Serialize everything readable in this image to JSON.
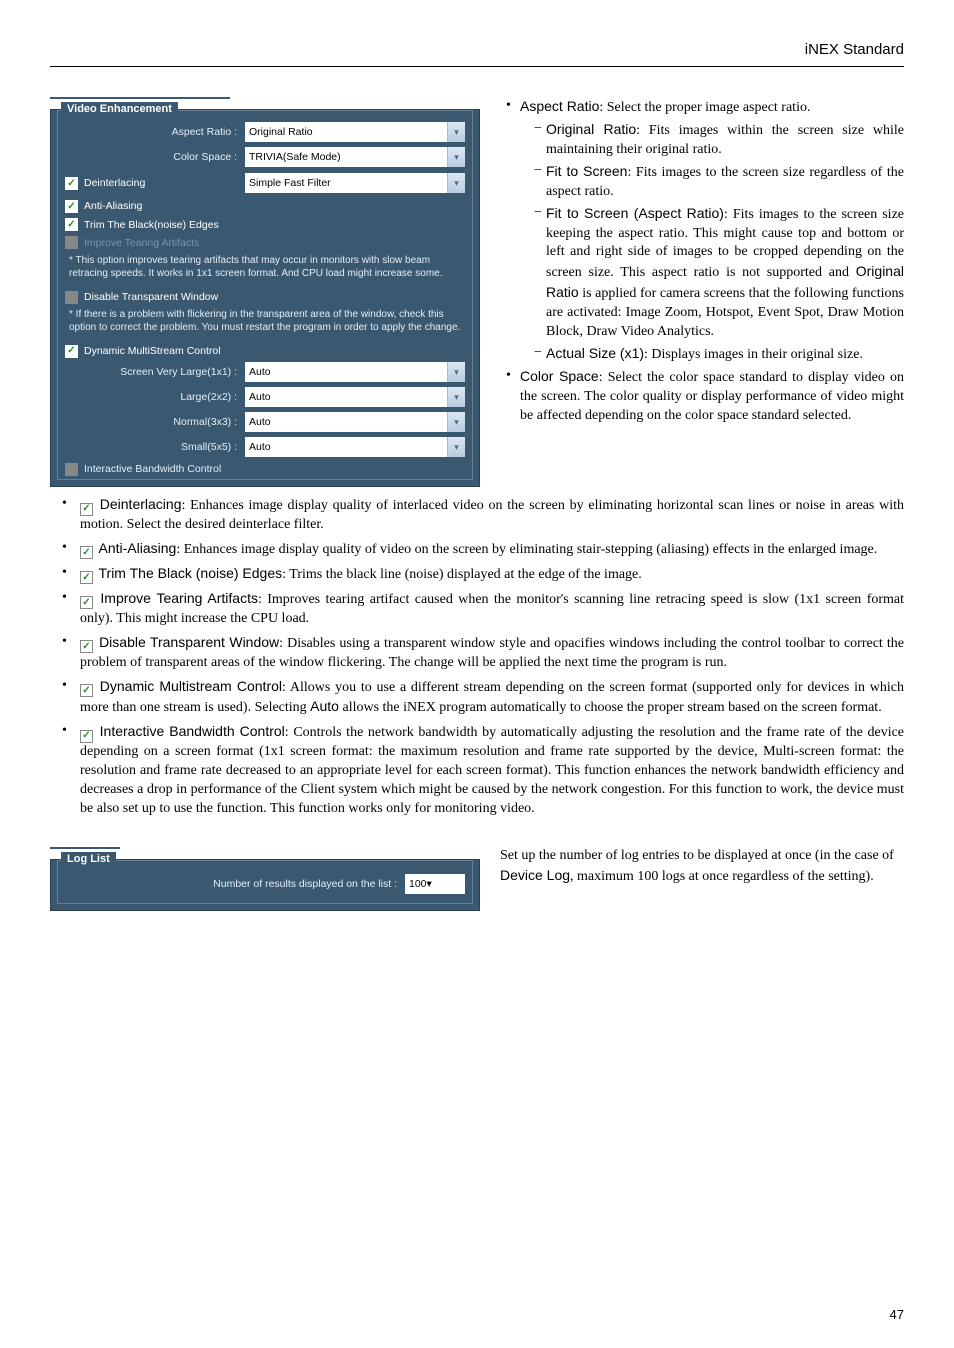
{
  "header": {
    "title": "iNEX Standard"
  },
  "videoPanel": {
    "title": "Video Enhancement",
    "aspectRatio": {
      "label": "Aspect Ratio :",
      "value": "Original Ratio"
    },
    "colorSpace": {
      "label": "Color Space :",
      "value": "TRIVIA(Safe Mode)"
    },
    "deinterlacing": {
      "label": "Deinterlacing",
      "filter": "Simple Fast Filter"
    },
    "antiAliasing": "Anti-Aliasing",
    "trimBlack": "Trim The Black(noise) Edges",
    "improveTearing": "Improve Tearing Artifacts",
    "note1": "* This option improves tearing artifacts that may occur in monitors with slow beam retracing speeds. It works in 1x1 screen format. And CPU load might increase some.",
    "disableTransparent": "Disable Transparent Window",
    "note2": "* If there is a problem with flickering in the transparent area of the window, check this option to correct the problem. You must restart the program in order to apply the change.",
    "dynamicMulti": "Dynamic MultiStream Control",
    "screenVeryLarge": {
      "label": "Screen Very Large(1x1) :",
      "value": "Auto"
    },
    "large": {
      "label": "Large(2x2) :",
      "value": "Auto"
    },
    "normal": {
      "label": "Normal(3x3) :",
      "value": "Auto"
    },
    "small": {
      "label": "Small(5x5) :",
      "value": "Auto"
    },
    "interactiveBandwidth": "Interactive Bandwidth Control"
  },
  "rightText": {
    "aspectRatioTitle": "Aspect Ratio",
    "aspectRatioDesc": ": Select the proper image aspect ratio.",
    "originalRatioTitle": "Original Ratio",
    "originalRatioDesc": ": Fits images within the screen size while maintaining their original ratio.",
    "fitScreenTitle": "Fit to Screen",
    "fitScreenDesc": ": Fits images to the screen size regardless of the aspect ratio.",
    "fitScreenARTitle": "Fit to Screen (Aspect Ratio)",
    "fitScreenARDesc": ": Fits images to the screen size keeping the aspect ratio.  This might cause top and bottom or left and right side of images to be cropped depending on the screen size.  This aspect ratio is not supported and ",
    "origRatioInline": "Original Ratio",
    "fitScreenARDesc2": " is applied for camera screens that the following functions are activated: Image Zoom, Hotspot, Event Spot, Draw Motion Block, Draw Video Analytics.",
    "actualSizeTitle": "Actual Size (x1)",
    "actualSizeDesc": ": Displays images in their original size.",
    "colorSpaceTitle": "Color Space",
    "colorSpaceDesc": ": Select the color space standard to display video on the screen.  The color quality or display performance of video might be affected depending on the color space standard selected."
  },
  "fullBullets": {
    "deinterlacingTitle": "Deinterlacing",
    "deinterlacingDesc": ": Enhances image display quality of interlaced video on the screen by eliminating horizontal scan lines or noise in areas with motion.  Select the desired deinterlace filter.",
    "antiAliasTitle": "Anti-Aliasing",
    "antiAliasDesc": ": Enhances image display quality of video on the screen by eliminating stair-stepping (aliasing) effects in the enlarged image.",
    "trimBlackTitle": "Trim The Black (noise) Edges",
    "trimBlackDesc": ": Trims the black line (noise) displayed at the edge of the image.",
    "improveTearTitle": "Improve Tearing Artifacts",
    "improveTearDesc": ": Improves tearing artifact caused when the monitor's scanning line retracing speed is slow (1x1 screen format only).  This might increase the CPU load.",
    "disableTransTitle": "Disable Transparent Window",
    "disableTransDesc": ": Disables using a transparent window style and opacifies windows including the control toolbar to correct the problem of transparent areas of the window flickering.  The change will be applied the next time the program is run.",
    "dynMultiTitle": "Dynamic Multistream Control",
    "dynMultiDesc": ": Allows you to use a different stream depending on the screen format (supported only for devices in which more than one stream is used).  Selecting ",
    "autoInline": "Auto",
    "dynMultiDesc2": " allows the iNEX program automatically to choose the proper stream based on the screen format.",
    "interBWTitle": "Interactive Bandwidth Control",
    "interBWDesc": ": Controls the network bandwidth by automatically adjusting the resolution and the frame rate of the device depending on a screen format (1x1 screen format: the maximum resolution and frame rate supported by the device, Multi-screen format: the resolution and frame rate decreased to an appropriate level for each screen format).  This function enhances the network bandwidth efficiency and decreases a drop in performance of the Client system which might be caused by the network congestion.  For this function to work, the device must be also set up to use the function.  This function works only for monitoring video."
  },
  "logPanel": {
    "title": "Log List",
    "label": "Number of results displayed on the list :",
    "value": "100"
  },
  "logDesc": {
    "part1": "Set up the number of log entries to be displayed at once (in the case of ",
    "deviceLog": "Device Log",
    "part2": ", maximum 100 logs at once regardless of the setting)."
  },
  "pageNumber": "47"
}
